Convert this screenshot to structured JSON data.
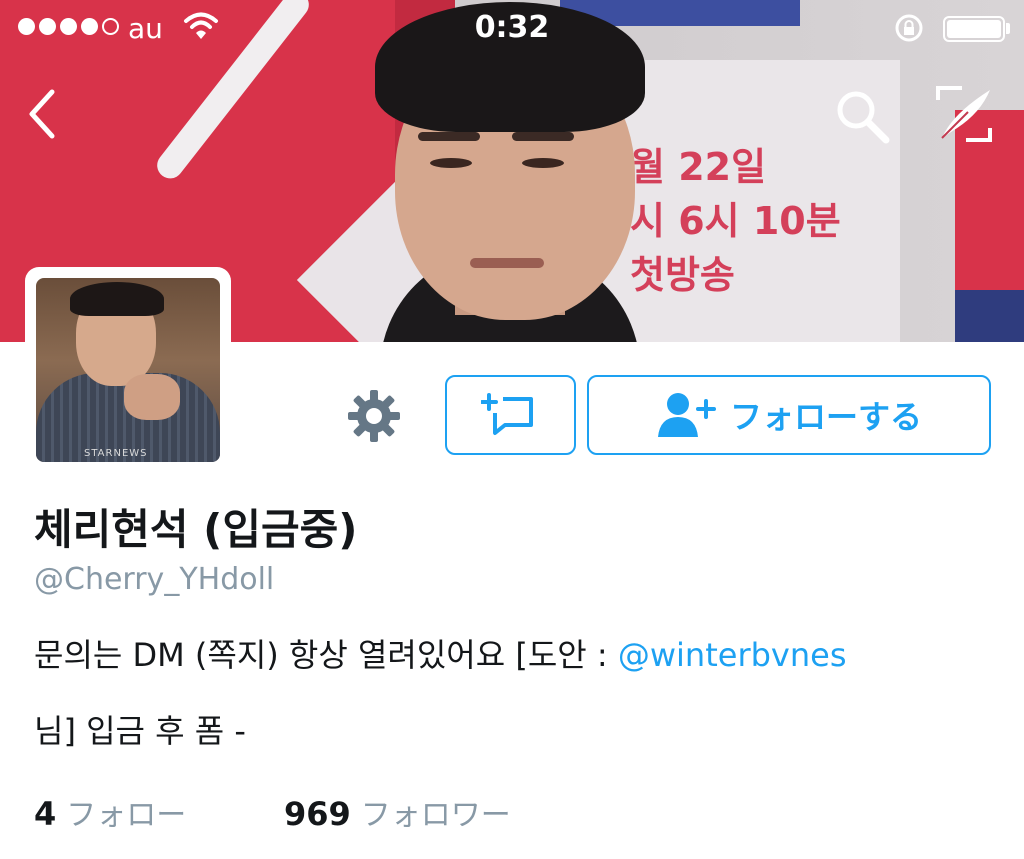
{
  "status_bar": {
    "carrier": "au",
    "time": "0:32",
    "signal_bars": 4,
    "signal_max": 5
  },
  "banner": {
    "poster_text": "월 22일\n시 6시 10분\n첫방송"
  },
  "nav": {
    "back_icon": "chevron-left-icon",
    "search_icon": "search-icon",
    "compose_icon": "compose-quill-icon"
  },
  "avatar": {
    "watermark": "STARNEWS"
  },
  "actions": {
    "settings_icon": "gear-icon",
    "list_icon": "add-to-list-icon",
    "follow_icon": "add-user-icon",
    "follow_label": "フォローする"
  },
  "profile": {
    "display_name": "체리현석 (입금중)",
    "handle": "@Cherry_YHdoll",
    "bio_line1_prefix": "문의는 DM (쪽지) 항상 열려있어요 [도안 : ",
    "bio_mention": "@winterbvnes",
    "bio_line2": "님] 입금 후 폼 -"
  },
  "stats": {
    "following_count": "4",
    "following_label": "フォロー",
    "followers_count": "969",
    "followers_label": "フォロワー"
  },
  "colors": {
    "accent": "#1da1f2",
    "secondary_text": "#8899a6",
    "primary_text": "#14171a"
  }
}
